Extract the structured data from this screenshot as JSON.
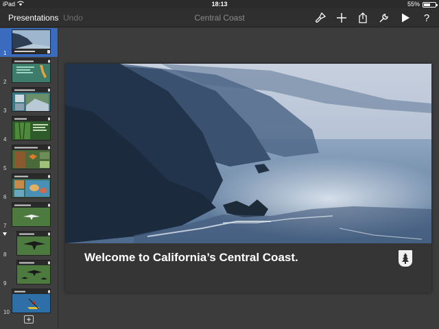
{
  "status_bar": {
    "device": "iPad",
    "time": "18:13",
    "battery_text": "55%",
    "battery_level": 0.55
  },
  "toolbar": {
    "back_label": "Presentations",
    "undo_label": "Undo",
    "title": "Central Coast",
    "icons": [
      "format-brush-icon",
      "plus-icon",
      "share-icon",
      "wrench-icon",
      "play-icon",
      "help-icon"
    ],
    "help_label": "?"
  },
  "navigator": {
    "selected_slide": 1,
    "slides": [
      {
        "number": "1",
        "theme": "coast-photo"
      },
      {
        "number": "2",
        "theme": "map"
      },
      {
        "number": "3",
        "theme": "photo-grid"
      },
      {
        "number": "4",
        "theme": "forest"
      },
      {
        "number": "5",
        "theme": "insects"
      },
      {
        "number": "6",
        "theme": "pools"
      },
      {
        "number": "7",
        "theme": "bird-single"
      },
      {
        "number": "8",
        "theme": "bird-large"
      },
      {
        "number": "9",
        "theme": "birds-many"
      },
      {
        "number": "10",
        "theme": "kayak"
      }
    ],
    "add_label": "+"
  },
  "slide": {
    "heading": "Welcome to California’s Central Coast."
  },
  "colors": {
    "selection": "#3a6bbf",
    "toolbar_bg": "#2f2f2f",
    "canvas_bg": "#3c3c3c",
    "caption_bg": "#353535"
  }
}
